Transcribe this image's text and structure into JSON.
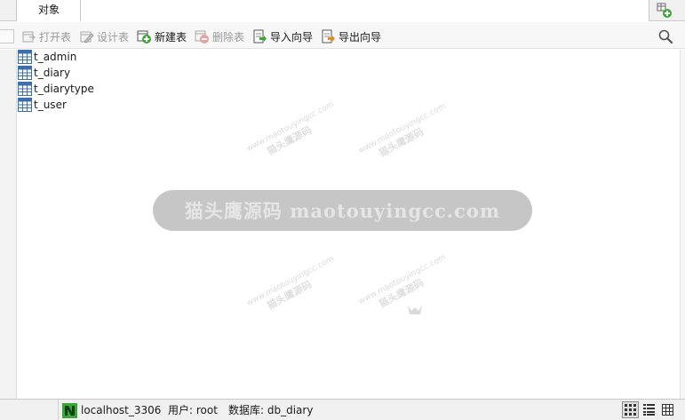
{
  "tabs": [
    {
      "label": "对象"
    }
  ],
  "toolbar": {
    "buttons": [
      {
        "label": "打开表",
        "icon": "open-table-icon",
        "enabled": false
      },
      {
        "label": "设计表",
        "icon": "design-table-icon",
        "enabled": false
      },
      {
        "label": "新建表",
        "icon": "new-table-icon",
        "enabled": true
      },
      {
        "label": "删除表",
        "icon": "delete-table-icon",
        "enabled": false
      },
      {
        "label": "导入向导",
        "icon": "import-wizard-icon",
        "enabled": true
      },
      {
        "label": "导出向导",
        "icon": "export-wizard-icon",
        "enabled": true
      }
    ]
  },
  "objects": [
    {
      "name": "t_admin"
    },
    {
      "name": "t_diary"
    },
    {
      "name": "t_diarytype"
    },
    {
      "name": "t_user"
    }
  ],
  "watermark": {
    "banner": "猫头鹰源码 maotouyingcc.com",
    "small_url": "www.maotouyingcc.com",
    "small_cn": "猫头鹰源码"
  },
  "status": {
    "connection": "localhost_3306",
    "user": "用户: root",
    "database": "数据库: db_diary"
  },
  "colors": {
    "accent_green": "#3aa63a",
    "import_orange": "#e88a1a",
    "table_blue": "#3b6fb0"
  }
}
